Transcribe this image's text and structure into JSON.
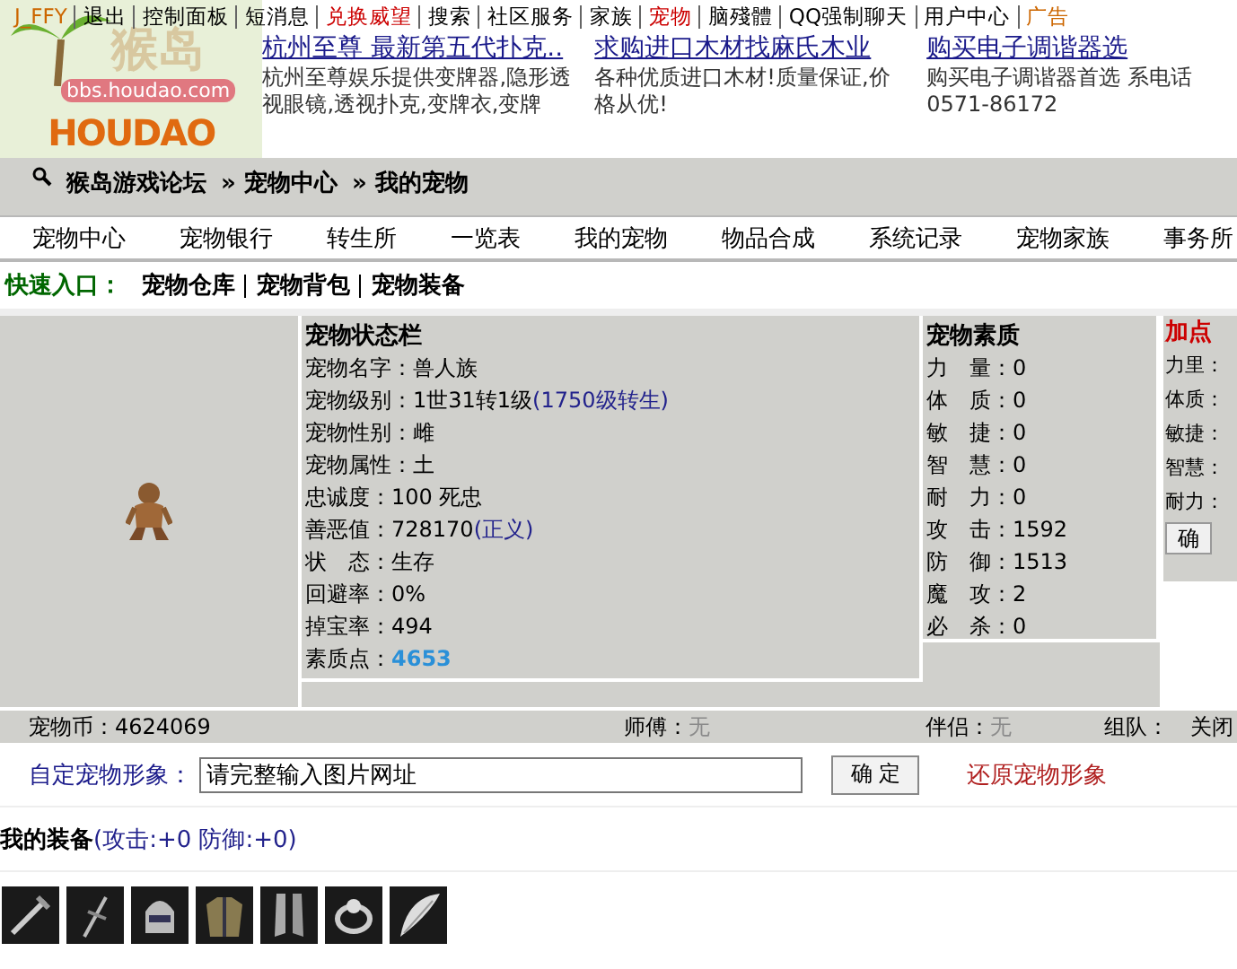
{
  "top_nav": [
    {
      "label": "J_FFY",
      "color": "#cc6600"
    },
    {
      "label": "退出",
      "color": "#000000"
    },
    {
      "label": "控制面板",
      "color": "#000000"
    },
    {
      "label": "短消息",
      "color": "#000000"
    },
    {
      "label": "兑换威望",
      "color": "#cc0000"
    },
    {
      "label": "搜索",
      "color": "#000000"
    },
    {
      "label": "社区服务",
      "color": "#000000"
    },
    {
      "label": "家族",
      "color": "#000000"
    },
    {
      "label": "宠物",
      "color": "#cc0000"
    },
    {
      "label": "脑殘體",
      "color": "#000000"
    },
    {
      "label": "QQ强制聊天",
      "color": "#000000"
    },
    {
      "label": "用户中心",
      "color": "#000000"
    },
    {
      "label": "广告",
      "color": "#cc6600"
    }
  ],
  "logo": {
    "title": "猴岛",
    "site": "bbs.houdao.com",
    "wordmark": "HOUDAO"
  },
  "ads": [
    {
      "title": "杭州至尊 最新第五代扑克..",
      "text": "杭州至尊娱乐提供变牌器,隐形透视眼镜,透视扑克,变牌衣,变牌"
    },
    {
      "title": "求购进口木材找麻氏木业",
      "text": "各种优质进口木材!质量保证,价格从优!"
    },
    {
      "title": "购买电子调谐器选",
      "text": "购买电子调谐器首选 系电话0571-86172"
    }
  ],
  "breadcrumb": [
    "猴岛游戏论坛",
    "» 宠物中心",
    "» 我的宠物"
  ],
  "menu": [
    "宠物中心",
    "宠物银行",
    "转生所",
    "一览表",
    "我的宠物",
    "物品合成",
    "系统记录",
    "宠物家族",
    "事务所"
  ],
  "quick_entry": {
    "label": "快速入口：",
    "links": [
      "宠物仓库",
      "宠物背包",
      "宠物装备"
    ]
  },
  "status": {
    "title": "宠物状态栏",
    "rows": [
      {
        "label": "宠物名字：",
        "value": "兽人族"
      },
      {
        "label": "宠物级别：",
        "value": "1世31转1级",
        "note": "(1750级转生)"
      },
      {
        "label": "宠物性别：",
        "value": "雌"
      },
      {
        "label": "宠物属性：",
        "value": "土"
      },
      {
        "label": "忠诚度：",
        "value": "100 死忠"
      },
      {
        "label": "善恶值：",
        "value": "728170",
        "note": "(正义)"
      },
      {
        "label": "状　态：",
        "value": "生存"
      },
      {
        "label": "回避率：",
        "value": "0%"
      },
      {
        "label": "掉宝率：",
        "value": "494"
      },
      {
        "label": "素质点：",
        "value": "4653",
        "kind": "points"
      }
    ]
  },
  "qualities": {
    "title": "宠物素质",
    "rows": [
      {
        "label": "力　量：",
        "value": "0"
      },
      {
        "label": "体　质：",
        "value": "0"
      },
      {
        "label": "敏　捷：",
        "value": "0"
      },
      {
        "label": "智　慧：",
        "value": "0"
      },
      {
        "label": "耐　力：",
        "value": "0"
      },
      {
        "label": "攻　击：",
        "value": "1592"
      },
      {
        "label": "防　御：",
        "value": "1513"
      },
      {
        "label": "魔　攻：",
        "value": "2"
      },
      {
        "label": "必　杀：",
        "value": "0"
      }
    ]
  },
  "add_points": {
    "title": "加点",
    "rows": [
      "力里：",
      "体质：",
      "敏捷：",
      "智慧：",
      "耐力："
    ],
    "button": "确"
  },
  "info_bar": {
    "coins_label": "宠物币：",
    "coins": "4624069",
    "master_label": "师傅：",
    "master": "无",
    "partner_label": "伴侣：",
    "partner": "无",
    "team_label": "组队：",
    "team": "关闭"
  },
  "custom_image": {
    "label": "自定宠物形象：",
    "value": "请完整输入图片网址",
    "button": "确 定",
    "restore": "还原宠物形象"
  },
  "equipment": {
    "title": "我的装备",
    "stats": "(攻击:+0 防御:+0)",
    "items": [
      {
        "kind": "sword"
      },
      {
        "kind": "dagger"
      },
      {
        "kind": "helmet"
      },
      {
        "kind": "armor"
      },
      {
        "kind": "boots"
      },
      {
        "kind": "ring"
      },
      {
        "kind": "wing"
      }
    ]
  }
}
